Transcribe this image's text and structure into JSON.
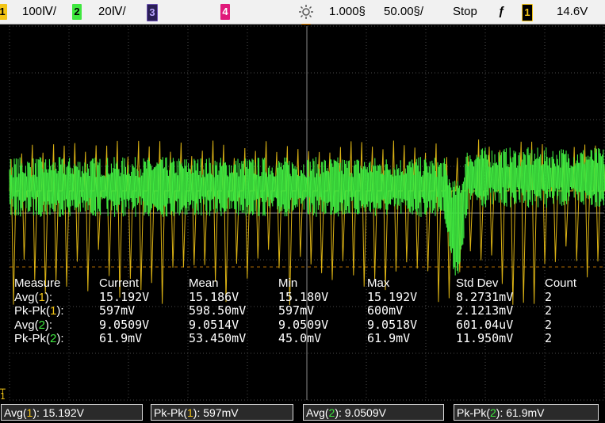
{
  "topbar": {
    "ch1_num": "1",
    "ch1_scale": "100Ⅳ/",
    "ch2_num": "2",
    "ch2_scale": "20Ⅳ/",
    "ch3_num": "3",
    "ch4_num": "4",
    "timebase": "1.000§",
    "time_scale": "50.00§/",
    "run_state": "Stop",
    "trigger_slope_glyph": "ƒ",
    "trig_ch_num": "1",
    "trig_level": "14.6V"
  },
  "colors": {
    "ch1": "#f3c516",
    "ch2": "#3fe73f",
    "ch3": "#6a4fb4",
    "ch4": "#e0197a",
    "marker": "#f08c00"
  },
  "icons": {
    "trigger_position": "sun-icon",
    "slope": "rising-edge-icon",
    "ground": "ground-marker-icon"
  },
  "measurements": {
    "headers": [
      "Measure",
      "Current",
      "Mean",
      "Min",
      "Max",
      "Std Dev",
      "Count"
    ],
    "rows": [
      {
        "pre": "Avg(",
        "ch": "1",
        "post": "):",
        "values": [
          "15.192V",
          "15.186V",
          "15.180V",
          "15.192V",
          "8.2731mV",
          "2"
        ]
      },
      {
        "pre": "Pk-Pk(",
        "ch": "1",
        "post": "):",
        "values": [
          "597mV",
          "598.50mV",
          "597mV",
          "600mV",
          "2.1213mV",
          "2"
        ]
      },
      {
        "pre": "Avg(",
        "ch": "2",
        "post": "):",
        "values": [
          "9.0509V",
          "9.0514V",
          "9.0509V",
          "9.0518V",
          "601.04uV",
          "2"
        ]
      },
      {
        "pre": "Pk-Pk(",
        "ch": "2",
        "post": "):",
        "values": [
          "61.9mV",
          "53.450mV",
          "45.0mV",
          "61.9mV",
          "11.950mV",
          "2"
        ]
      }
    ]
  },
  "bottombar": [
    {
      "pre": "Avg(",
      "ch": "1",
      "post": "): 15.192V"
    },
    {
      "pre": "Pk-Pk(",
      "ch": "1",
      "post": "): 597mV"
    },
    {
      "pre": "Avg(",
      "ch": "2",
      "post": "): 9.0509V"
    },
    {
      "pre": "Pk-Pk(",
      "ch": "2",
      "post": "): 61.9mV"
    }
  ]
}
